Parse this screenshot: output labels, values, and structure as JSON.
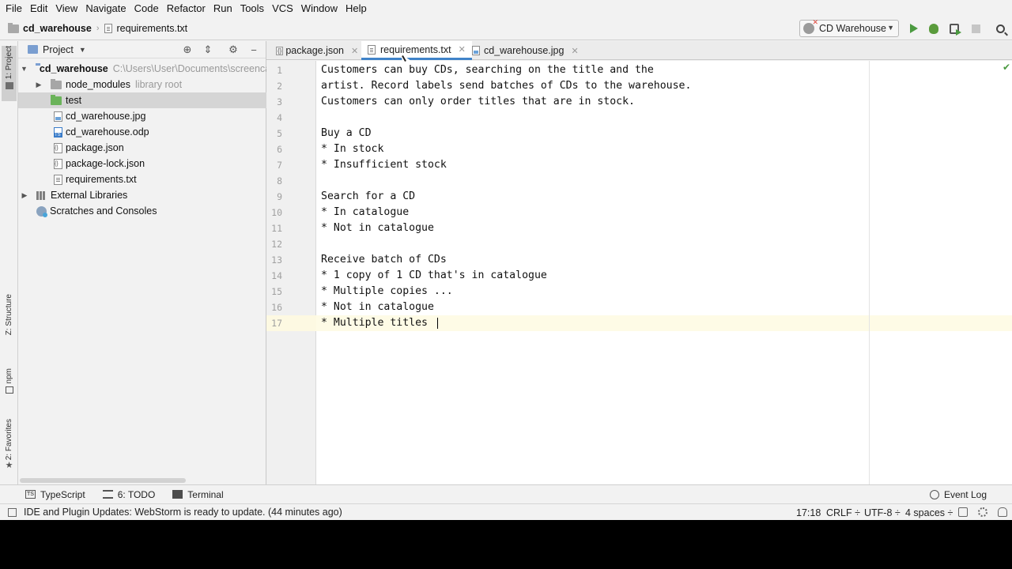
{
  "menu": [
    "File",
    "Edit",
    "View",
    "Navigate",
    "Code",
    "Refactor",
    "Run",
    "Tools",
    "VCS",
    "Window",
    "Help"
  ],
  "breadcrumb": {
    "project": "cd_warehouse",
    "file": "requirements.txt"
  },
  "run_config": {
    "label": "CD Warehouse"
  },
  "project_panel": {
    "title": "Project",
    "tree": [
      {
        "label": "cd_warehouse",
        "path": "C:\\Users\\User\\Documents\\screenca"
      },
      {
        "label": "node_modules",
        "note": "library root"
      },
      {
        "label": "test"
      },
      {
        "label": "cd_warehouse.jpg"
      },
      {
        "label": "cd_warehouse.odp"
      },
      {
        "label": "package.json"
      },
      {
        "label": "package-lock.json"
      },
      {
        "label": "requirements.txt"
      },
      {
        "label": "External Libraries"
      },
      {
        "label": "Scratches and Consoles"
      }
    ]
  },
  "left_strip": {
    "project_tab": "1: Project",
    "structure_tab": "Z: Structure",
    "npm_tab": "npm",
    "favorites_tab": "2: Favorites"
  },
  "editor_tabs": [
    {
      "label": "package.json"
    },
    {
      "label": "requirements.txt",
      "active": true
    },
    {
      "label": "cd_warehouse.jpg"
    }
  ],
  "editor": {
    "line_numbers": [
      "1",
      "2",
      "3",
      "4",
      "5",
      "6",
      "7",
      "8",
      "9",
      "10",
      "11",
      "12",
      "13",
      "14",
      "15",
      "16",
      "17"
    ],
    "lines": [
      "Customers can buy CDs, searching on the title and the",
      "artist. Record labels send batches of CDs to the warehouse.",
      "Customers can only order titles that are in stock.",
      "",
      "Buy a CD",
      "* In stock",
      "* Insufficient stock",
      "",
      "Search for a CD",
      "* In catalogue",
      "* Not in catalogue",
      "",
      "Receive batch of CDs",
      "* 1 copy of 1 CD that's in catalogue",
      "* Multiple copies ...",
      "* Not in catalogue",
      "* Multiple titles"
    ]
  },
  "bottom_tools": {
    "typescript": "TypeScript",
    "todo": "6: TODO",
    "terminal": "Terminal",
    "event_log": "Event Log"
  },
  "status": {
    "message": "IDE and Plugin Updates: WebStorm is ready to update. (44 minutes ago)",
    "position": "17:18",
    "line_sep": "CRLF ÷",
    "encoding": "UTF-8 ÷",
    "indent": "4 spaces ÷"
  },
  "colors": {
    "accent": "#4083c9",
    "run_green": "#4b9a40",
    "caret_row": "#fefbe6"
  }
}
